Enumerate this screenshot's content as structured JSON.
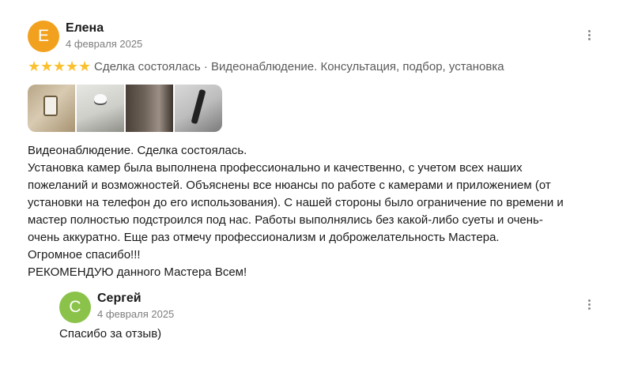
{
  "review": {
    "author": "Елена",
    "initial": "Е",
    "avatar_color": "#f2a11e",
    "date": "4 февраля 2025",
    "rating": 5,
    "rating_max": 5,
    "meta": "Сделка состоялась · Видеонаблюдение. Консультация, подбор, установка",
    "text_lines": [
      "Видеонаблюдение. Сделка состоялась.",
      "Установка камер была выполнена профессионально и качественно, с учетом всех наших",
      "пожеланий и возможностей. Объяснены все нюансы по работе с камерами и приложением (от",
      "установки на телефон до его использования). С нашей стороны было ограничение по времени и",
      "мастер полностью подстроился под нас. Работы выполнялись без какой-либо суеты и очень-",
      "очень аккуратно. Еще раз отмечу профессионализм и доброжелательность Мастера.",
      "Огромное спасибо!!!",
      "РЕКОМЕНДУЮ данного Мастера Всем!"
    ]
  },
  "reply": {
    "author": "Сергей",
    "initial": "С",
    "avatar_color": "#8bc34a",
    "date": "4 февраля 2025",
    "text": "Спасибо за отзыв)"
  },
  "star_color": "#fbc02d"
}
